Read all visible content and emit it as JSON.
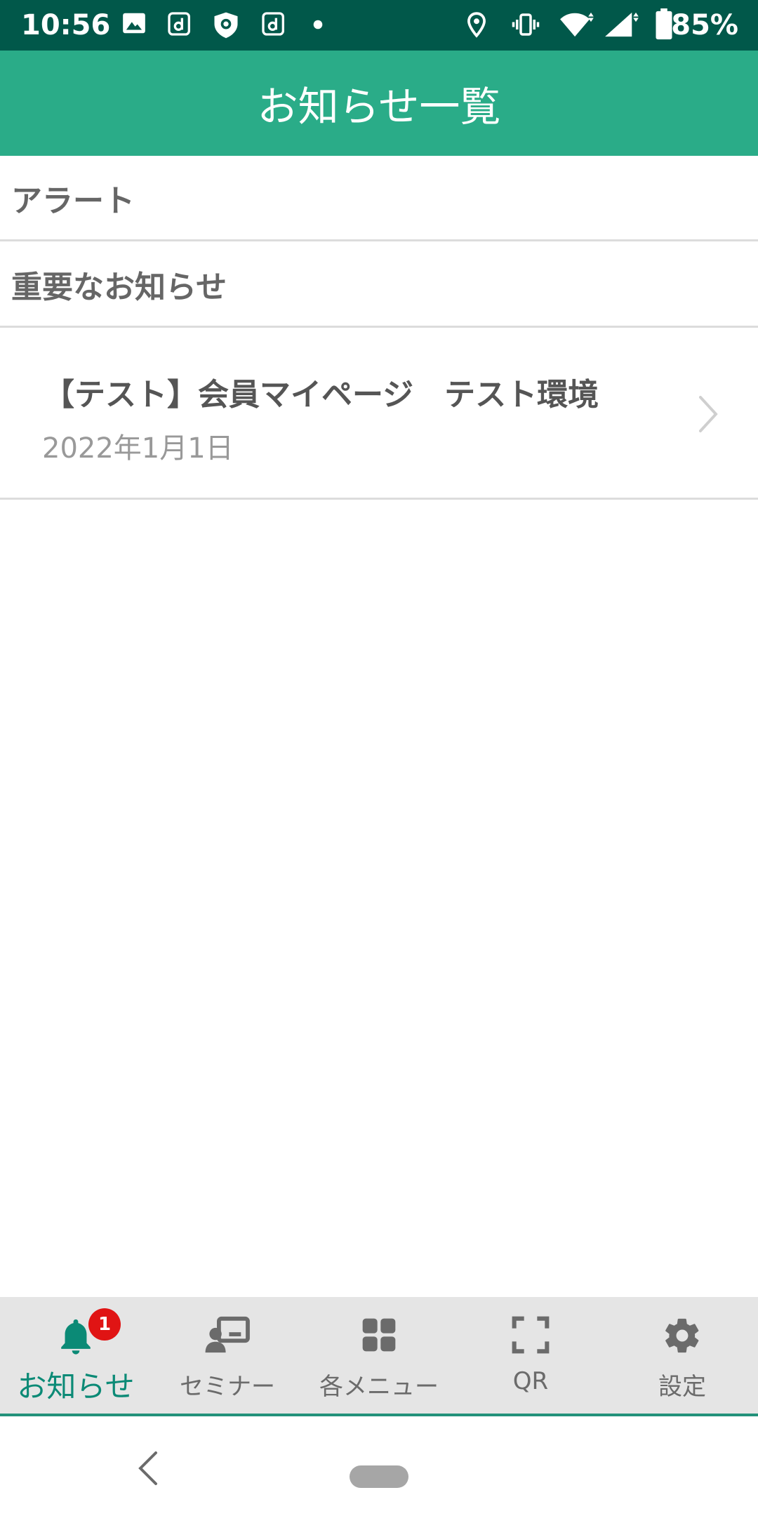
{
  "status_bar": {
    "time": "10:56",
    "battery": "85%",
    "icons": [
      "image-icon",
      "d-app-icon",
      "shield-icon",
      "d-app-icon",
      "dot-icon",
      "location-icon",
      "vibrate-icon",
      "wifi-icon",
      "signal-icon",
      "battery-icon"
    ]
  },
  "header": {
    "title": "お知らせ一覧"
  },
  "sections": [
    {
      "label": "アラート"
    },
    {
      "label": "重要なお知らせ"
    }
  ],
  "notices": [
    {
      "title": "【テスト】会員マイページ　テスト環境",
      "date": "2022年1月1日"
    }
  ],
  "bottom_nav": {
    "items": [
      {
        "label": "お知らせ",
        "icon": "bell-icon",
        "badge": "1",
        "active": true
      },
      {
        "label": "セミナー",
        "icon": "seminar-icon"
      },
      {
        "label": "各メニュー",
        "icon": "grid-icon"
      },
      {
        "label": "QR",
        "icon": "qr-scan-icon"
      },
      {
        "label": "設定",
        "icon": "gear-icon"
      }
    ]
  },
  "colors": {
    "status_bar": "#01584a",
    "header": "#2aac88",
    "active_tab": "#0b8a76",
    "badge": "#e01414"
  }
}
